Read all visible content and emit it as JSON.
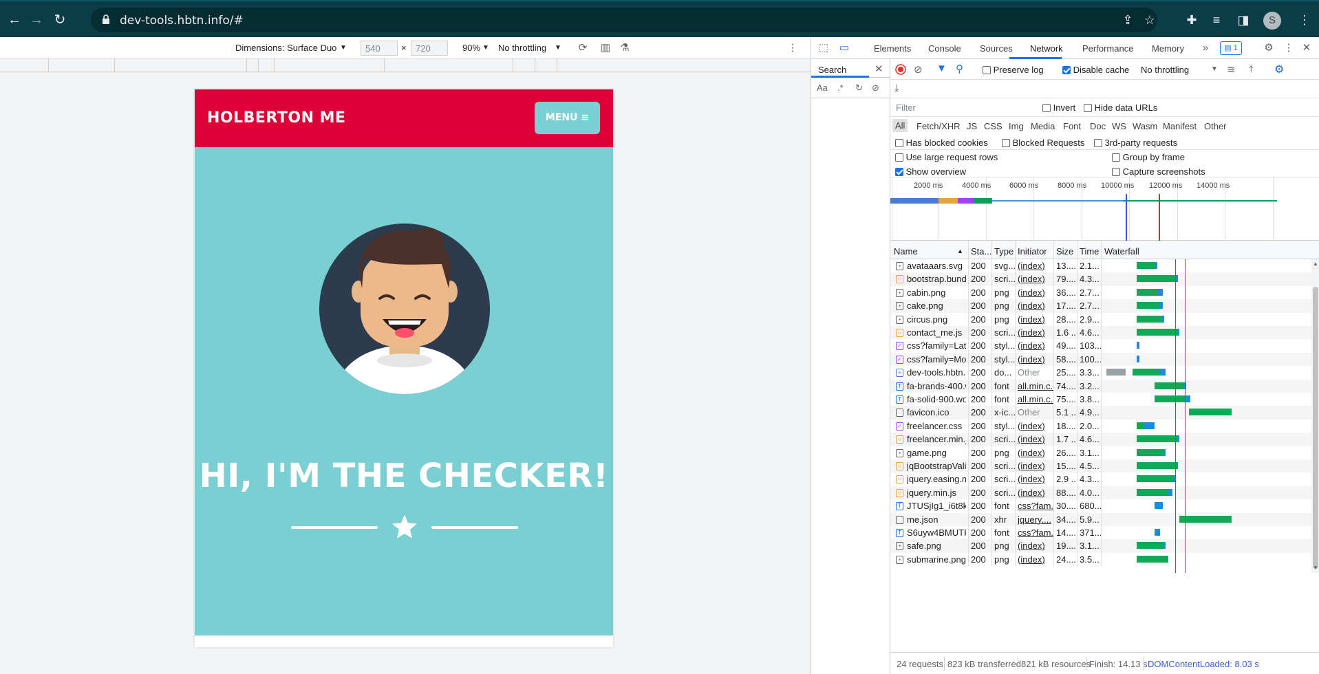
{
  "browser": {
    "url": "dev-tools.hbtn.info/#",
    "avatar_letter": "S"
  },
  "device_toolbar": {
    "dimensions_label": "Dimensions: Surface Duo",
    "width": "540",
    "times": "×",
    "height": "720",
    "zoom": "90%",
    "throttling": "No throttling"
  },
  "site": {
    "brand": "HOLBERTON ME",
    "menu_label": "MENU ≡",
    "hero_title": "HI, I'M THE CHECKER!",
    "nav_color": "#dc0036",
    "masthead_color": "#7acfd3"
  },
  "devtools": {
    "tabs": [
      "Elements",
      "Console",
      "Sources",
      "Network",
      "Performance",
      "Memory"
    ],
    "active_tab": "Network",
    "issues_count": "1",
    "search_tab": "Search",
    "search_opt_case": "Aa",
    "search_opt_regex": ".*",
    "toolbar": {
      "preserve_log": "Preserve log",
      "disable_cache": "Disable cache",
      "throttling": "No throttling"
    },
    "filter": {
      "placeholder": "Filter",
      "invert": "Invert",
      "hide_data_urls": "Hide data URLs"
    },
    "types": [
      "All",
      "Fetch/XHR",
      "JS",
      "CSS",
      "Img",
      "Media",
      "Font",
      "Doc",
      "WS",
      "Wasm",
      "Manifest",
      "Other"
    ],
    "options": {
      "has_blocked_cookies": "Has blocked cookies",
      "blocked_requests": "Blocked Requests",
      "third_party": "3rd-party requests",
      "large_rows": "Use large request rows",
      "group_by_frame": "Group by frame",
      "show_overview": "Show overview",
      "capture_screenshots": "Capture screenshots"
    },
    "overview_ticks": [
      "2000 ms",
      "4000 ms",
      "6000 ms",
      "8000 ms",
      "10000 ms",
      "12000 ms",
      "14000 ms"
    ],
    "columns": [
      "Name",
      "Sta...",
      "Type",
      "Initiator",
      "Size",
      "Time",
      "Waterfall"
    ],
    "requests": [
      {
        "name": "avataaars.svg",
        "status": "200",
        "type": "svg...",
        "initiator": "(index)",
        "size": "13....",
        "time": "2.1...",
        "icon": "image"
      },
      {
        "name": "bootstrap.bundl...",
        "status": "200",
        "type": "scri...",
        "initiator": "(index)",
        "size": "79....",
        "time": "4.3...",
        "icon": "script"
      },
      {
        "name": "cabin.png",
        "status": "200",
        "type": "png",
        "initiator": "(index)",
        "size": "36....",
        "time": "2.7...",
        "icon": "image"
      },
      {
        "name": "cake.png",
        "status": "200",
        "type": "png",
        "initiator": "(index)",
        "size": "17....",
        "time": "2.7...",
        "icon": "image"
      },
      {
        "name": "circus.png",
        "status": "200",
        "type": "png",
        "initiator": "(index)",
        "size": "28....",
        "time": "2.9...",
        "icon": "image"
      },
      {
        "name": "contact_me.js",
        "status": "200",
        "type": "scri...",
        "initiator": "(index)",
        "size": "1.6 ...",
        "time": "4.6...",
        "icon": "script"
      },
      {
        "name": "css?family=Lato...",
        "status": "200",
        "type": "styl...",
        "initiator": "(index)",
        "size": "49....",
        "time": "103...",
        "icon": "style"
      },
      {
        "name": "css?family=Mon...",
        "status": "200",
        "type": "styl...",
        "initiator": "(index)",
        "size": "58....",
        "time": "100...",
        "icon": "style"
      },
      {
        "name": "dev-tools.hbtn.i...",
        "status": "200",
        "type": "do...",
        "initiator": "Other",
        "size": "25....",
        "time": "3.3...",
        "icon": "doc"
      },
      {
        "name": "fa-brands-400.w...",
        "status": "200",
        "type": "font",
        "initiator": "all.min.c...",
        "size": "74....",
        "time": "3.2...",
        "icon": "font"
      },
      {
        "name": "fa-solid-900.wof...",
        "status": "200",
        "type": "font",
        "initiator": "all.min.c...",
        "size": "75....",
        "time": "3.8...",
        "icon": "font"
      },
      {
        "name": "favicon.ico",
        "status": "200",
        "type": "x-ic...",
        "initiator": "Other",
        "size": "5.1 ...",
        "time": "4.9...",
        "icon": "other"
      },
      {
        "name": "freelancer.css",
        "status": "200",
        "type": "styl...",
        "initiator": "(index)",
        "size": "18....",
        "time": "2.0...",
        "icon": "style"
      },
      {
        "name": "freelancer.min.js",
        "status": "200",
        "type": "scri...",
        "initiator": "(index)",
        "size": "1.7 ...",
        "time": "4.6...",
        "icon": "script"
      },
      {
        "name": "game.png",
        "status": "200",
        "type": "png",
        "initiator": "(index)",
        "size": "26....",
        "time": "3.1...",
        "icon": "image"
      },
      {
        "name": "jqBootstrapVali...",
        "status": "200",
        "type": "scri...",
        "initiator": "(index)",
        "size": "15....",
        "time": "4.5...",
        "icon": "script"
      },
      {
        "name": "jquery.easing.mi...",
        "status": "200",
        "type": "scri...",
        "initiator": "(index)",
        "size": "2.9 ...",
        "time": "4.3...",
        "icon": "script"
      },
      {
        "name": "jquery.min.js",
        "status": "200",
        "type": "scri...",
        "initiator": "(index)",
        "size": "88....",
        "time": "4.0...",
        "icon": "script"
      },
      {
        "name": "JTUSjIg1_i6t8kC...",
        "status": "200",
        "type": "font",
        "initiator": "css?fam...",
        "size": "30....",
        "time": "680...",
        "icon": "font"
      },
      {
        "name": "me.json",
        "status": "200",
        "type": "xhr",
        "initiator": "jquery....",
        "size": "34....",
        "time": "5.9...",
        "icon": "other"
      },
      {
        "name": "S6uyw4BMUTP...",
        "status": "200",
        "type": "font",
        "initiator": "css?fam...",
        "size": "14....",
        "time": "371...",
        "icon": "font"
      },
      {
        "name": "safe.png",
        "status": "200",
        "type": "png",
        "initiator": "(index)",
        "size": "19....",
        "time": "3.1...",
        "icon": "image"
      },
      {
        "name": "submarine.png",
        "status": "200",
        "type": "png",
        "initiator": "(index)",
        "size": "24....",
        "time": "3.5...",
        "icon": "image"
      }
    ],
    "status": {
      "requests": "24 requests",
      "transferred": "823 kB transferred",
      "resources": "821 kB resources",
      "finish": "Finish: 14.13 s",
      "dom_loaded": "DOMContentLoaded: 8.03 s"
    }
  }
}
